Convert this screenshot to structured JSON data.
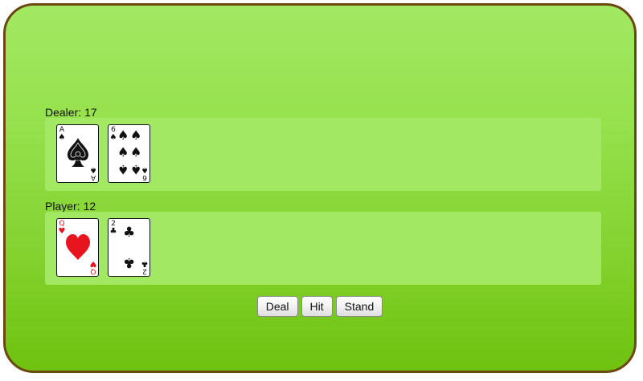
{
  "dealer": {
    "label": "Dealer:",
    "score": "17",
    "cards": [
      {
        "rank": "A",
        "suit": "♠",
        "color": "black",
        "name": "ace-of-spades"
      },
      {
        "rank": "6",
        "suit": "♠",
        "color": "black",
        "name": "six-of-spades"
      }
    ]
  },
  "player": {
    "label": "Player:",
    "score": "12",
    "cards": [
      {
        "rank": "Q",
        "suit": "♥",
        "color": "red",
        "name": "queen-of-hearts"
      },
      {
        "rank": "2",
        "suit": "♣",
        "color": "black",
        "name": "two-of-clubs"
      }
    ]
  },
  "controls": {
    "deal_label": "Deal",
    "hit_label": "Hit",
    "stand_label": "Stand"
  },
  "colors": {
    "felt": "#97e24f",
    "border": "#6b4712",
    "red_suit": "#e8141e",
    "black_suit": "#111111"
  }
}
